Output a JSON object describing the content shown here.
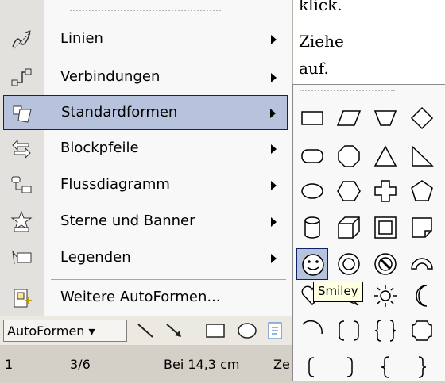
{
  "document": {
    "lines": [
      "klick.",
      "Ziehe",
      "auf."
    ]
  },
  "menu": {
    "items": [
      {
        "label": "Linien",
        "has_submenu": true,
        "icon": "lines-icon"
      },
      {
        "label": "Verbindungen",
        "has_submenu": true,
        "icon": "connectors-icon"
      },
      {
        "label": "Standardformen",
        "has_submenu": true,
        "icon": "basic-shapes-icon",
        "selected": true
      },
      {
        "label": "Blockpfeile",
        "has_submenu": true,
        "icon": "block-arrows-icon"
      },
      {
        "label": "Flussdiagramm",
        "has_submenu": true,
        "icon": "flowchart-icon"
      },
      {
        "label": "Sterne und Banner",
        "has_submenu": true,
        "icon": "stars-banners-icon"
      },
      {
        "label": "Legenden",
        "has_submenu": true,
        "icon": "callouts-icon"
      },
      {
        "label": "Weitere AutoFormen...",
        "has_submenu": false,
        "icon": "more-autoshapes-icon"
      }
    ]
  },
  "toolbar": {
    "autoformen_label": "AutoFormen ▾"
  },
  "status": {
    "page": "1",
    "section": "3/6",
    "position": "Bei 14,3 cm",
    "line": "Ze"
  },
  "submenu": {
    "shapes": [
      "rectangle",
      "parallelogram",
      "trapezoid",
      "diamond",
      "rounded-rectangle",
      "octagon",
      "triangle",
      "right-triangle",
      "oval",
      "hexagon",
      "cross",
      "pentagon",
      "can",
      "cube",
      "bevel",
      "folded-corner",
      "smiley",
      "donut",
      "no-symbol",
      "block-arc",
      "heart",
      "lightning",
      "sun",
      "moon",
      "arc",
      "bracket-pair",
      "brace-pair",
      "plaque",
      "left-bracket",
      "right-bracket",
      "left-brace",
      "right-brace"
    ],
    "selected_shape": "smiley"
  },
  "tooltip": {
    "text": "Smiley"
  },
  "colors": {
    "highlight": "#b7c3dc",
    "highlight_border": "#0a246a",
    "menu_bg": "#f8f8f8"
  }
}
